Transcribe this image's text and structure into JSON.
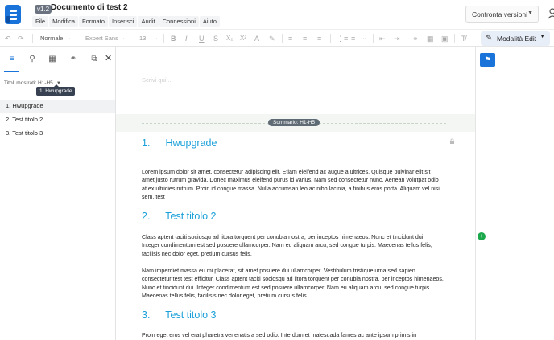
{
  "header": {
    "version": "v1.2",
    "title": "Documento di test 2",
    "menu": [
      "File",
      "Modifica",
      "Formato",
      "Inserisci",
      "Audit",
      "Connessioni",
      "Aiuto"
    ],
    "compare_label": "Confronta versioni"
  },
  "toolbar": {
    "style": "Normale",
    "font": "Expert Sans",
    "size": "13",
    "mode_label": "Modalità Edit",
    "icons": [
      "undo-icon",
      "redo-icon",
      "bold-icon",
      "italic-icon",
      "underline-icon",
      "strikethrough-icon",
      "subscript-icon",
      "superscript-icon",
      "text-color-icon",
      "align-left-icon",
      "align-center-icon",
      "align-right-icon",
      "bullet-list-icon",
      "numbered-list-icon",
      "outdent-icon",
      "indent-icon",
      "link-icon",
      "table-icon",
      "image-icon",
      "clear-format-icon"
    ]
  },
  "sidebar": {
    "filter_label": "Titoli mostrati: H1-H5",
    "tooltip": "1. Hwupgrade",
    "items": [
      "1. Hwupgrade",
      "2. Test titolo 2",
      "3. Test titolo 3"
    ]
  },
  "editor": {
    "placeholder": "Scrivi qui...",
    "summary_label": "Sommario: H1-H5",
    "sections": [
      {
        "num": "1.",
        "title": "Hwupgrade",
        "paragraphs": [
          "Lorem ipsum dolor sit amet, consectetur adipiscing elit. Etiam eleifend ac augue a ultrices. Quisque pulvinar elit sit amet justo rutrum gravida. Donec maximus eleifend purus id varius. Nam sed consectetur nunc. Aenean volutpat odio at ex ultricies rutrum. Proin id congue massa. Nulla accumsan leo ac nibh lacinia, a finibus eros porta. Aliquam vel nisi sem. test"
        ]
      },
      {
        "num": "2.",
        "title": "Test titolo 2",
        "paragraphs": [
          "Class aptent taciti sociosqu ad litora torquent per conubia nostra, per inceptos himenaeos. Nunc et tincidunt dui. Integer condimentum est sed posuere ullamcorper. Nam eu aliquam arcu, sed congue turpis. Maecenas tellus felis, facilisis nec dolor eget, pretium cursus felis.",
          "Nam imperdiet massa eu mi placerat, sit amet posuere dui ullamcorper. Vestibulum tristique urna sed sapien consectetur test test efficitur. Class aptent taciti sociosqu ad litora torquent per conubia nostra, per inceptos himenaeos. Nunc et tincidunt dui. Integer condimentum est sed posuere ullamcorper. Nam eu aliquam arcu, sed congue turpis. Maecenas tellus felis, facilisis nec dolor eget, pretium cursus felis."
        ]
      },
      {
        "num": "3.",
        "title": "Test titolo 3",
        "paragraphs": [
          "Proin eget eros vel erat pharetra venenatis a sed odio. Interdum et malesuada fames ac ante ipsum primis in"
        ]
      }
    ]
  },
  "colors": {
    "accent": "#1a73d8",
    "heading": "#1aa0d8",
    "comment": "#1aa84b"
  }
}
